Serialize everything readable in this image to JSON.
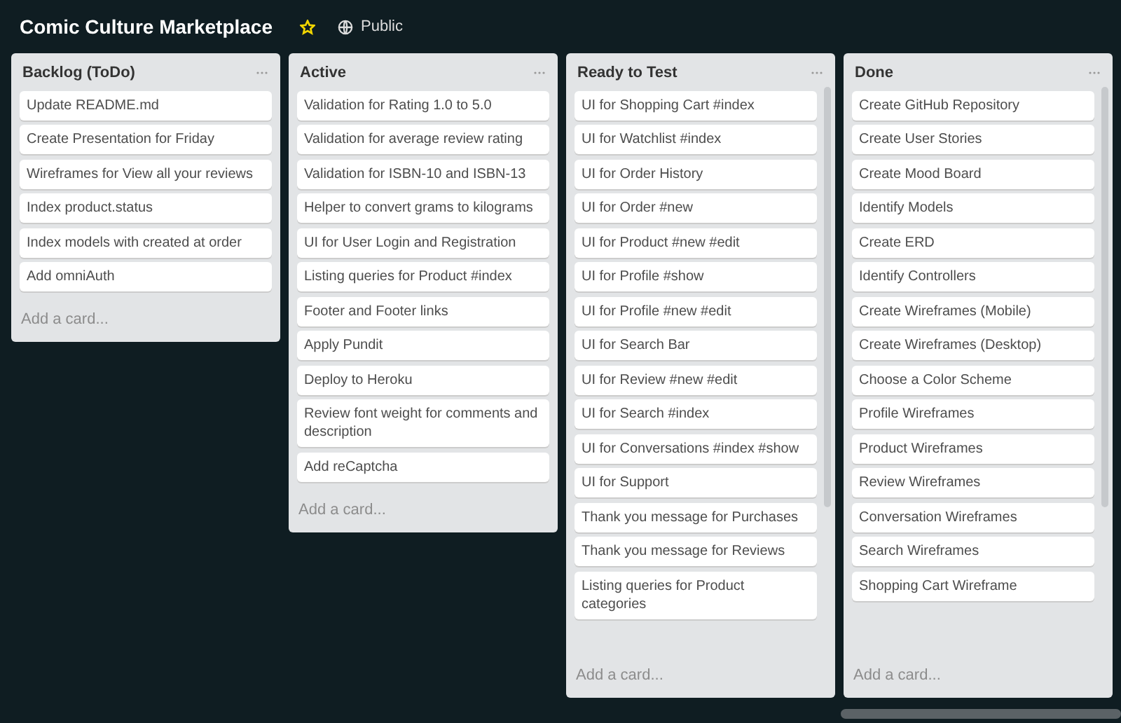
{
  "board": {
    "title": "Comic Culture Marketplace",
    "starred": true,
    "visibility": "Public"
  },
  "lists": [
    {
      "title": "Backlog (ToDo)",
      "cards": [
        "Update README.md",
        "Create Presentation for Friday",
        "Wireframes for View all your reviews",
        "Index product.status",
        "Index models with created at order",
        "Add omniAuth"
      ],
      "add_card": "Add a card..."
    },
    {
      "title": "Active",
      "cards": [
        "Validation for Rating 1.0 to 5.0",
        "Validation for average review rating",
        "Validation for ISBN-10 and ISBN-13",
        "Helper to convert grams to kilograms",
        "UI for User Login and Registration",
        "Listing queries for Product #index",
        "Footer and Footer links",
        "Apply Pundit",
        "Deploy to Heroku",
        "Review font weight for comments and description",
        "Add reCaptcha"
      ],
      "add_card": "Add a card..."
    },
    {
      "title": "Ready to Test",
      "cards": [
        "UI for Shopping Cart #index",
        "UI for Watchlist #index",
        "UI for Order History",
        "UI for Order #new",
        "UI for Product #new #edit",
        "UI for Profile #show",
        "UI for Profile #new #edit",
        "UI for Search Bar",
        "UI for Review #new #edit",
        "UI for Search #index",
        "UI for Conversations #index #show",
        "UI for Support",
        "Thank you message for Purchases",
        "Thank you message for Reviews",
        "Listing queries for Product categories"
      ],
      "add_card": "Add a card..."
    },
    {
      "title": "Done",
      "cards": [
        "Create GitHub Repository",
        "Create User Stories",
        "Create Mood Board",
        "Identify Models",
        "Create ERD",
        "Identify Controllers",
        "Create Wireframes (Mobile)",
        "Create Wireframes (Desktop)",
        "Choose a Color Scheme",
        "Profile Wireframes",
        "Product Wireframes",
        "Review Wireframes",
        "Conversation Wireframes",
        "Search Wireframes",
        "Shopping Cart Wireframe"
      ],
      "add_card": "Add a card..."
    }
  ]
}
